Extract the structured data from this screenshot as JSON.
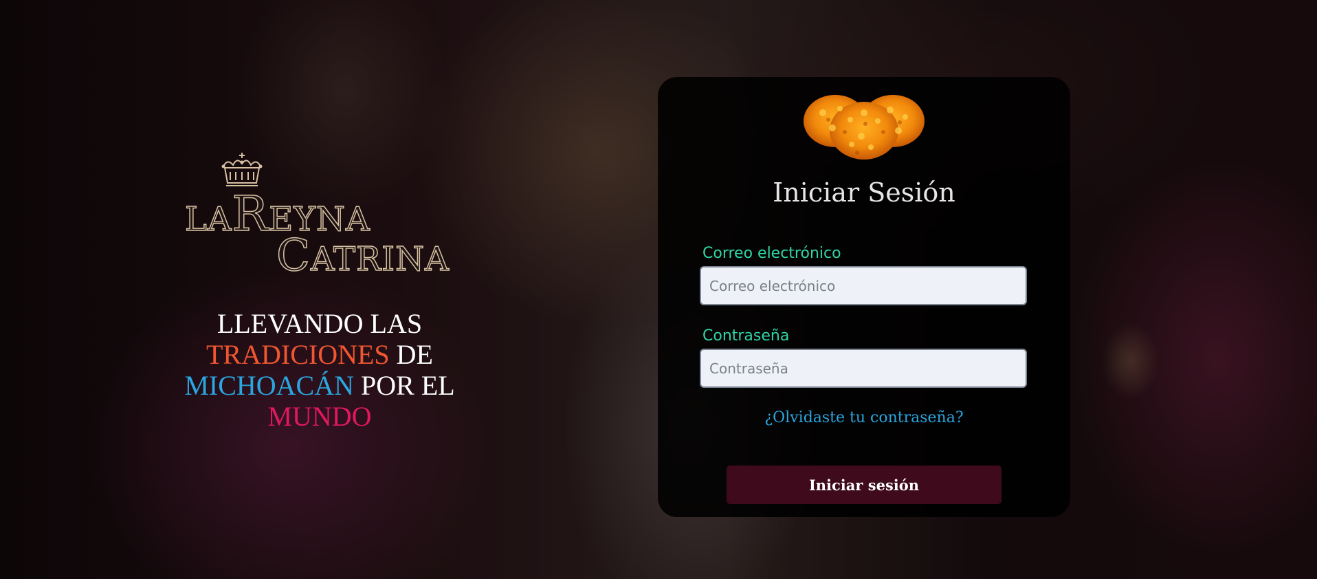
{
  "brand": {
    "logo_line1_prefix": "LA",
    "logo_line1_initial": "R",
    "logo_line1_rest": "EYNA",
    "logo_line2_initial": "C",
    "logo_line2_rest": "ATRINA",
    "crown_icon": "crown-icon",
    "tagline": {
      "part1": "LLEVANDO LAS",
      "part2": "TRADICIONES",
      "part3": " DE",
      "part4": "MICHOACÁN",
      "part5": " POR EL",
      "part6": "MUNDO"
    },
    "colors": {
      "tradiciones": "#f0562f",
      "michoacan": "#2aa6e0",
      "mundo": "#e0185e",
      "logo_outline": "#d8c2a2"
    }
  },
  "login": {
    "flower_icon": "marigold-flower-icon",
    "title": "Iniciar Sesión",
    "email_label": "Correo electrónico",
    "email_placeholder": "Correo electrónico",
    "email_value": "",
    "password_label": "Contraseña",
    "password_placeholder": "Contraseña",
    "password_value": "",
    "forgot_link": "¿Olvidaste tu contraseña?",
    "submit_label": "Iniciar sesión",
    "colors": {
      "label": "#2fd6a6",
      "link": "#2aa6e0",
      "button_bg": "#3e0a1c"
    }
  }
}
